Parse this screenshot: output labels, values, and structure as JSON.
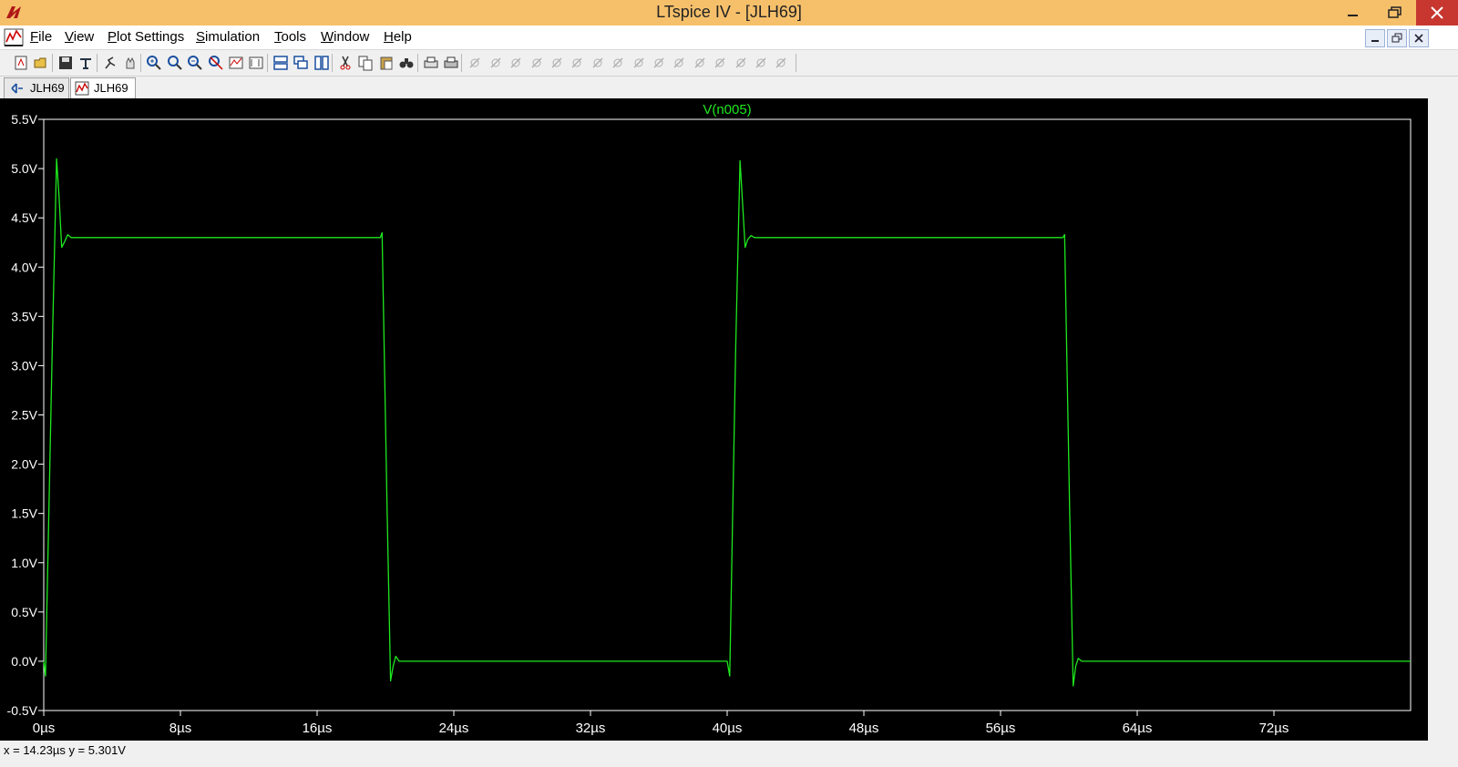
{
  "window": {
    "title": "LTspice IV - [JLH69]",
    "colors": {
      "titlebar": "#f6c06b",
      "close": "#c7372f",
      "trace": "#1ee81e",
      "plot_bg": "#000000"
    }
  },
  "menu": {
    "items": [
      {
        "id": "file",
        "label": "File",
        "accel": "F"
      },
      {
        "id": "view",
        "label": "View",
        "accel": "V"
      },
      {
        "id": "plot-settings",
        "label": "Plot Settings",
        "accel": "P"
      },
      {
        "id": "simulation",
        "label": "Simulation",
        "accel": "S"
      },
      {
        "id": "tools",
        "label": "Tools",
        "accel": "T"
      },
      {
        "id": "window",
        "label": "Window",
        "accel": "W"
      },
      {
        "id": "help",
        "label": "Help",
        "accel": "H"
      }
    ]
  },
  "toolbar": {
    "icons": [
      "new-schematic-icon",
      "open-icon",
      "save-icon",
      "control-panel-icon",
      "run-icon",
      "halt-icon",
      "zoom-area-icon",
      "zoom-in-icon",
      "zoom-out-icon",
      "zoom-fit-icon",
      "autorange-icon",
      "add-trace-icon",
      "tile-horizontal-icon",
      "cascade-icon",
      "tile-vertical-icon",
      "cut-icon",
      "copy-icon",
      "paste-icon",
      "find-icon",
      "print-preview-icon",
      "print-icon",
      "wire-icon",
      "ground-icon",
      "label-icon",
      "resistor-icon",
      "capacitor-icon",
      "inductor-icon",
      "diode-icon",
      "component-icon",
      "move-icon",
      "drag-icon",
      "undo-icon",
      "redo-icon",
      "rotate-icon",
      "mirror-icon",
      "text-icon",
      "spice-directive-icon"
    ]
  },
  "tabs": [
    {
      "label": "JLH69",
      "icon": "schematic-tab-icon",
      "active": false
    },
    {
      "label": "JLH69",
      "icon": "waveform-tab-icon",
      "active": true
    }
  ],
  "chart_data": {
    "type": "line",
    "title": "V(n005)",
    "xlim": [
      0,
      80
    ],
    "ylim": [
      -0.5,
      5.5
    ],
    "x_ticks": [
      "0µs",
      "8µs",
      "16µs",
      "24µs",
      "32µs",
      "40µs",
      "48µs",
      "56µs",
      "64µs",
      "72µs"
    ],
    "x_tick_values": [
      0,
      8,
      16,
      24,
      32,
      40,
      48,
      56,
      64,
      72
    ],
    "y_ticks": [
      "-0.5V",
      "0.0V",
      "0.5V",
      "1.0V",
      "1.5V",
      "2.0V",
      "2.5V",
      "3.0V",
      "3.5V",
      "4.0V",
      "4.5V",
      "5.0V",
      "5.5V"
    ],
    "y_tick_values": [
      -0.5,
      0,
      0.5,
      1,
      1.5,
      2,
      2.5,
      3,
      3.5,
      4,
      4.5,
      5,
      5.5
    ],
    "series": [
      {
        "name": "V(n005)",
        "x": [
          0,
          0.1,
          0.5,
          0.75,
          0.9,
          1.05,
          1.2,
          1.4,
          1.6,
          2.0,
          14.0,
          19.7,
          19.8,
          20.1,
          20.3,
          20.45,
          20.6,
          20.8,
          21.2,
          40.0,
          40.15,
          40.5,
          40.75,
          40.9,
          41.05,
          41.2,
          41.4,
          41.6,
          42.0,
          54.0,
          59.65,
          59.75,
          60.05,
          60.25,
          60.4,
          60.55,
          60.75,
          61.2,
          80.0
        ],
        "y": [
          0,
          -0.15,
          3.2,
          5.1,
          4.7,
          4.2,
          4.25,
          4.33,
          4.3,
          4.3,
          4.3,
          4.3,
          4.35,
          1.5,
          -0.2,
          -0.05,
          0.05,
          0.0,
          0.0,
          0.0,
          -0.15,
          3.2,
          5.08,
          4.65,
          4.2,
          4.28,
          4.32,
          4.3,
          4.3,
          4.3,
          4.3,
          4.33,
          1.5,
          -0.25,
          -0.05,
          0.03,
          0.0,
          0.0,
          0.0
        ]
      }
    ]
  },
  "status": {
    "cursor_readout": "x = 14.23µs   y = 5.301V"
  }
}
